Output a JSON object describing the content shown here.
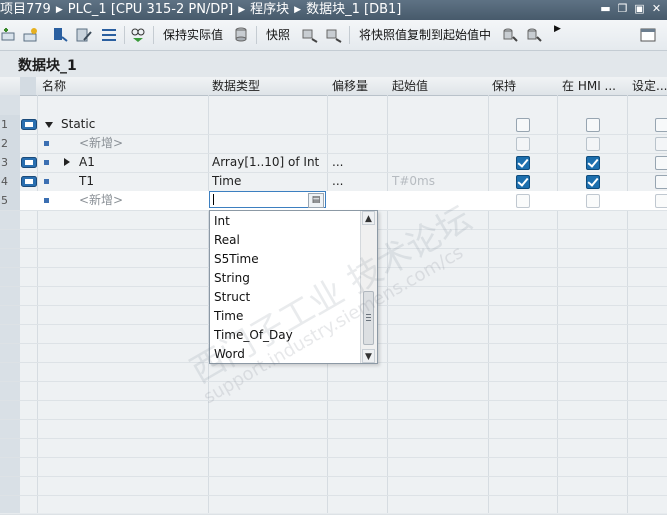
{
  "titlebar": {
    "crumbs": [
      "项目779",
      "PLC_1 [CPU 315-2 PN/DP]",
      "程序块",
      "数据块_1 [DB1]"
    ]
  },
  "toolbar": {
    "keep_actual_label": "保持实际值",
    "snapshot_label": "快照",
    "copy_snapshot_label": "将快照值复制到起始值中"
  },
  "block_title": "数据块_1",
  "columns": {
    "name": "名称",
    "datatype": "数据类型",
    "offset": "偏移量",
    "start_value": "起始值",
    "retain": "保持",
    "hmi": "在 HMI ...",
    "setpoint": "设定..."
  },
  "rows": [
    {
      "num": "1",
      "name": "Static",
      "datatype": "",
      "offset": "",
      "start": "",
      "retain": false,
      "hmi": false
    },
    {
      "num": "2",
      "name": "<新增>",
      "datatype": "",
      "offset": "",
      "start": "",
      "retain": false,
      "hmi": false
    },
    {
      "num": "3",
      "name": "A1",
      "datatype": "Array[1..10] of Int",
      "offset": "...",
      "start": "",
      "retain": true,
      "hmi": true
    },
    {
      "num": "4",
      "name": "T1",
      "datatype": "Time",
      "offset": "...",
      "start": "T#0ms",
      "retain": true,
      "hmi": true
    },
    {
      "num": "5",
      "name": "<新增>",
      "datatype": "",
      "offset": "",
      "start": "",
      "retain": false,
      "hmi": false
    }
  ],
  "dropdown": {
    "options": [
      "Int",
      "Real",
      "S5Time",
      "String",
      "Struct",
      "Time",
      "Time_Of_Day",
      "Word"
    ]
  },
  "watermark": {
    "main": "西门子工业 技术论坛",
    "url": "support.industry.siemens.com/cs"
  }
}
